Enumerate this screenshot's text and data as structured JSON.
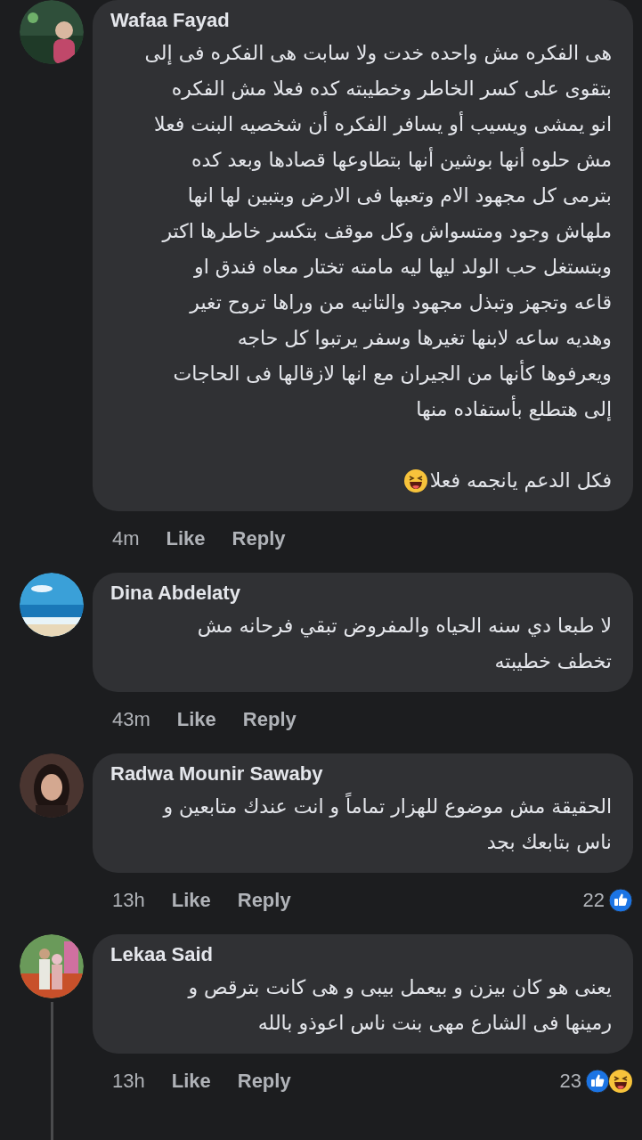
{
  "comments": [
    {
      "author": "Wafaa Fayad",
      "avatar": {
        "kind": "picture"
      },
      "paragraphs": [
        "هى الفكره مش واحده خدت ولا سابت هى الفكره فى إلى\nبتقوى على كسر الخاطر وخطيبته كده فعلا  مش الفكره\nانو يمشى ويسيب أو يسافر الفكره أن شخصيه البنت فعلا\nمش حلوه أنها بوشين أنها بتطاوعها قصادها وبعد كده\nبترمى كل مجهود الام وتعبها فى الارض وبتبين لها انها\nملهاش وجود ومتسواش وكل موقف بتكسر خاطرها اكتر\nوبتستغل حب الولد ليها ليه مامته تختار معاه فندق او\nقاعه وتجهز وتبذل مجهود والتانيه من وراها تروح تغير\nوهديه ساعه لابنها تغيرها وسفر يرتبوا كل حاجه\nويعرفوها كأنها من الجيران مع انها لازقالها فى الحاجات\nإلى هتطلع بأستفاده منها",
        "فكل الدعم يانجمه فعلا"
      ],
      "emoji": true,
      "time": "4m",
      "like": "Like",
      "reply": "Reply",
      "thread": false
    },
    {
      "author": "Dina Abdelaty",
      "avatar": {
        "kind": "picture"
      },
      "paragraphs": [
        "لا طبعا دي سنه الحياه والمفروض تبقي فرحانه مش\nتخطف خطيبته"
      ],
      "emoji": false,
      "time": "43m",
      "like": "Like",
      "reply": "Reply",
      "thread": false
    },
    {
      "author": "Radwa Mounir Sawaby",
      "avatar": {
        "kind": "picture"
      },
      "paragraphs": [
        "الحقيقة مش موضوع للهزار تماماً و انت عندك متابعين و\nناس بتابعك بجد"
      ],
      "emoji": false,
      "time": "13h",
      "like": "Like",
      "reply": "Reply",
      "reaction_count": "22",
      "reactions": [
        {
          "kind": "like"
        }
      ],
      "thread": false
    },
    {
      "author": "Lekaa Said",
      "avatar": {
        "kind": "picture"
      },
      "paragraphs": [
        "يعنى هو كان بيزن و بيعمل بيبى و هى كانت بترقص و\nرمينها فى الشارع مهى بنت ناس اعوذو بالله"
      ],
      "emoji": false,
      "time": "13h",
      "like": "Like",
      "reply": "Reply",
      "reaction_count": "23",
      "reactions": [
        {
          "kind": "like"
        },
        {
          "kind": "haha"
        }
      ],
      "thread": true
    }
  ]
}
